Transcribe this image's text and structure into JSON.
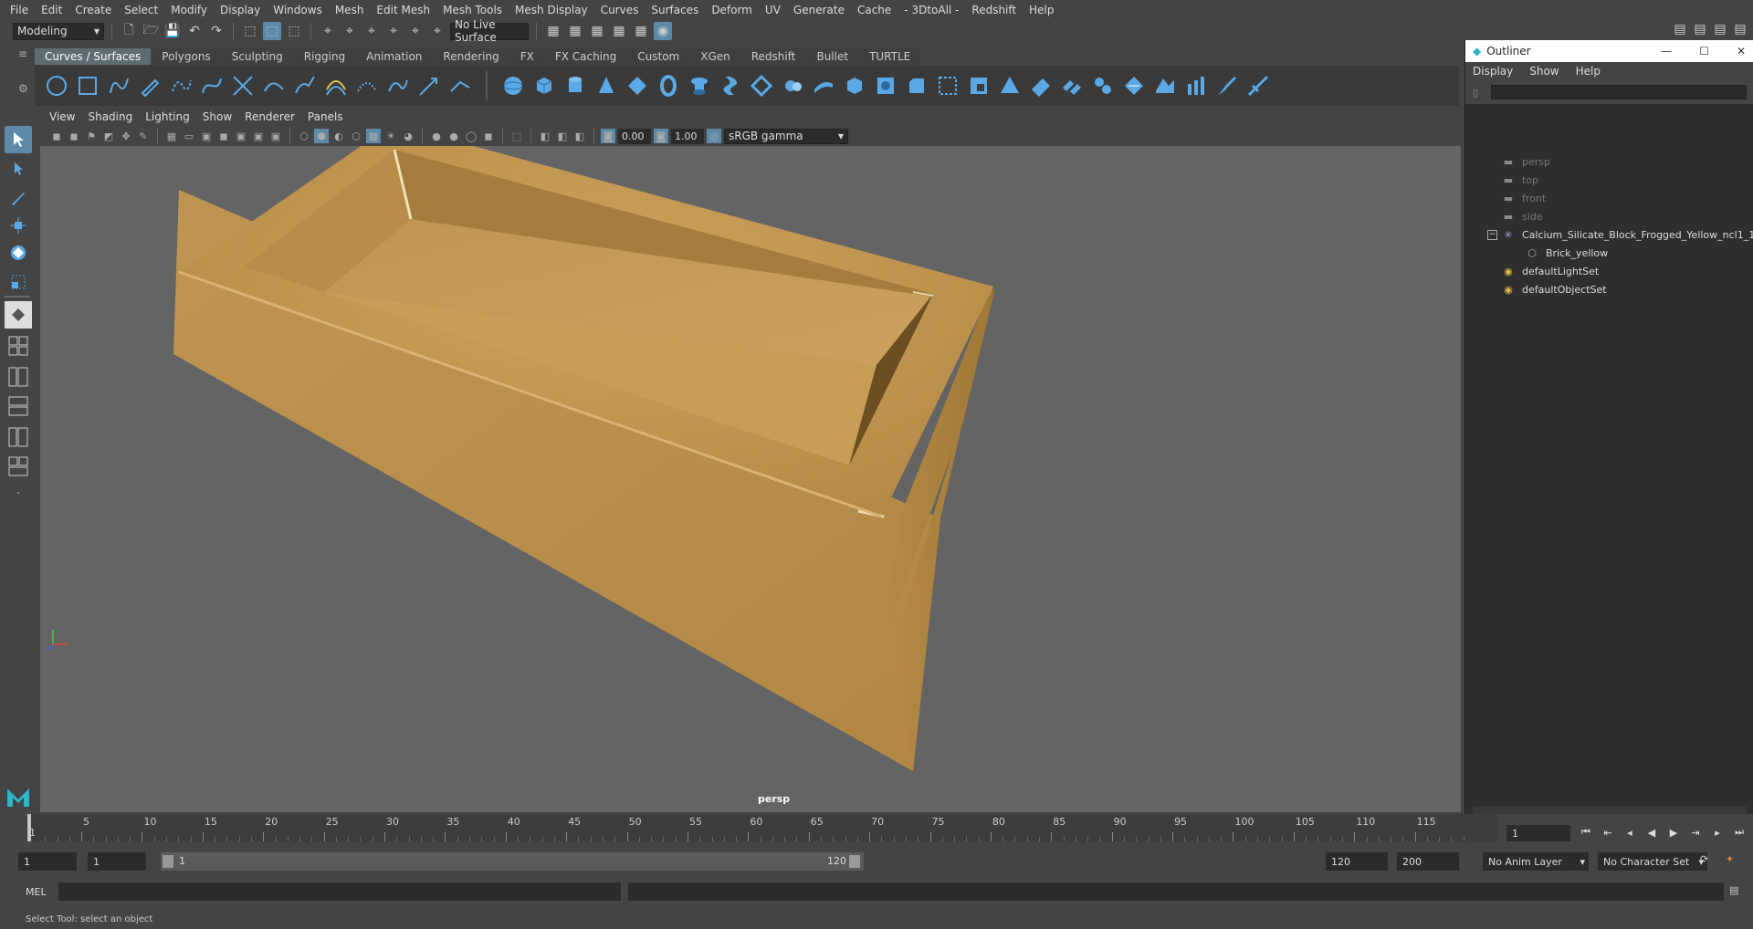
{
  "menubar": {
    "items": [
      "File",
      "Edit",
      "Create",
      "Select",
      "Modify",
      "Display",
      "Windows",
      "Mesh",
      "Edit Mesh",
      "Mesh Tools",
      "Mesh Display",
      "Curves",
      "Surfaces",
      "Deform",
      "UV",
      "Generate",
      "Cache",
      "- 3DtoAll -",
      "Redshift",
      "Help"
    ]
  },
  "statusline": {
    "workspace": "Modeling",
    "live_surface": "No Live Surface"
  },
  "shelf": {
    "tabs": [
      "Curves / Surfaces",
      "Polygons",
      "Sculpting",
      "Rigging",
      "Animation",
      "Rendering",
      "FX",
      "FX Caching",
      "Custom",
      "XGen",
      "Redshift",
      "Bullet",
      "TURTLE"
    ],
    "active_tab": "Curves / Surfaces"
  },
  "panel": {
    "menus": [
      "View",
      "Shading",
      "Lighting",
      "Show",
      "Renderer",
      "Panels"
    ],
    "exposure": "0.00",
    "gamma": "1.00",
    "color_space": "sRGB gamma",
    "camera_label": "persp"
  },
  "outliner": {
    "title": "Outliner",
    "menus": [
      "Display",
      "Show",
      "Help"
    ],
    "items": [
      {
        "label": "persp",
        "icon": "camera-icon",
        "dim": true
      },
      {
        "label": "top",
        "icon": "camera-icon",
        "dim": true
      },
      {
        "label": "front",
        "icon": "camera-icon",
        "dim": true
      },
      {
        "label": "side",
        "icon": "camera-icon",
        "dim": true
      },
      {
        "label": "Calcium_Silicate_Block_Frogged_Yellow_ncl1_1",
        "icon": "transform-icon",
        "dim": false
      },
      {
        "label": "Brick_yellow",
        "icon": "mesh-icon",
        "dim": false
      },
      {
        "label": "defaultLightSet",
        "icon": "set-icon",
        "dim": false
      },
      {
        "label": "defaultObjectSet",
        "icon": "set-icon",
        "dim": false
      }
    ]
  },
  "timeline": {
    "ticks": [
      "5",
      "10",
      "15",
      "20",
      "25",
      "30",
      "35",
      "40",
      "45",
      "50",
      "55",
      "60",
      "65",
      "70",
      "75",
      "80",
      "85",
      "90",
      "95",
      "100",
      "105",
      "110",
      "115"
    ],
    "first_tick": "1",
    "current_frame": "1"
  },
  "range": {
    "start": "1",
    "playback_start": "1",
    "slider_start": "1",
    "slider_end": "120",
    "playback_end": "120",
    "end": "200",
    "anim_layer": "No Anim Layer",
    "character_set": "No Character Set"
  },
  "command": {
    "label": "MEL"
  },
  "help": {
    "text": "Select Tool: select an object"
  },
  "colors": {
    "accent": "#5d8aa8",
    "brick": "#c9a05a",
    "viewport_bg": "#646464"
  }
}
